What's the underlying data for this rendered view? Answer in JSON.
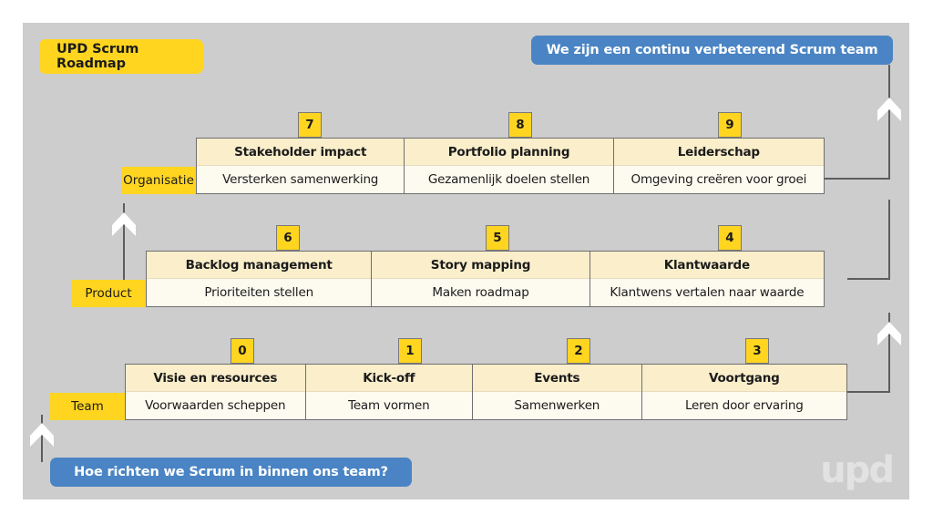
{
  "title": "UPD Scrum Roadmap",
  "banners": {
    "top": "We zijn een continu verbeterend Scrum team",
    "bottom": "Hoe richten we Scrum in binnen ons team?"
  },
  "logo": "upd",
  "colors": {
    "canvas": "#cdcdcd",
    "accent_yellow": "#ffd520",
    "banner_blue": "#4a84c4",
    "card_header": "#faeecb",
    "card_body": "#fdfaef",
    "border": "#6f6f6f",
    "line": "#5d5d5d",
    "arrow": "#ffffff"
  },
  "lanes": [
    {
      "label": "Organisatie",
      "cards": [
        {
          "number": "7",
          "title": "Stakeholder impact",
          "subtitle": "Versterken samenwerking"
        },
        {
          "number": "8",
          "title": "Portfolio planning",
          "subtitle": "Gezamenlijk doelen stellen"
        },
        {
          "number": "9",
          "title": "Leiderschap",
          "subtitle": "Omgeving creëren voor groei"
        }
      ]
    },
    {
      "label": "Product",
      "cards": [
        {
          "number": "6",
          "title": "Backlog management",
          "subtitle": "Prioriteiten stellen"
        },
        {
          "number": "5",
          "title": "Story mapping",
          "subtitle": "Maken roadmap"
        },
        {
          "number": "4",
          "title": "Klantwaarde",
          "subtitle": "Klantwens vertalen naar waarde"
        }
      ]
    },
    {
      "label": "Team",
      "cards": [
        {
          "number": "0",
          "title": "Visie en resources",
          "subtitle": "Voorwaarden scheppen"
        },
        {
          "number": "1",
          "title": "Kick-off",
          "subtitle": "Team vormen"
        },
        {
          "number": "2",
          "title": "Events",
          "subtitle": "Samenwerken"
        },
        {
          "number": "3",
          "title": "Voortgang",
          "subtitle": "Leren door ervaring"
        }
      ]
    }
  ]
}
